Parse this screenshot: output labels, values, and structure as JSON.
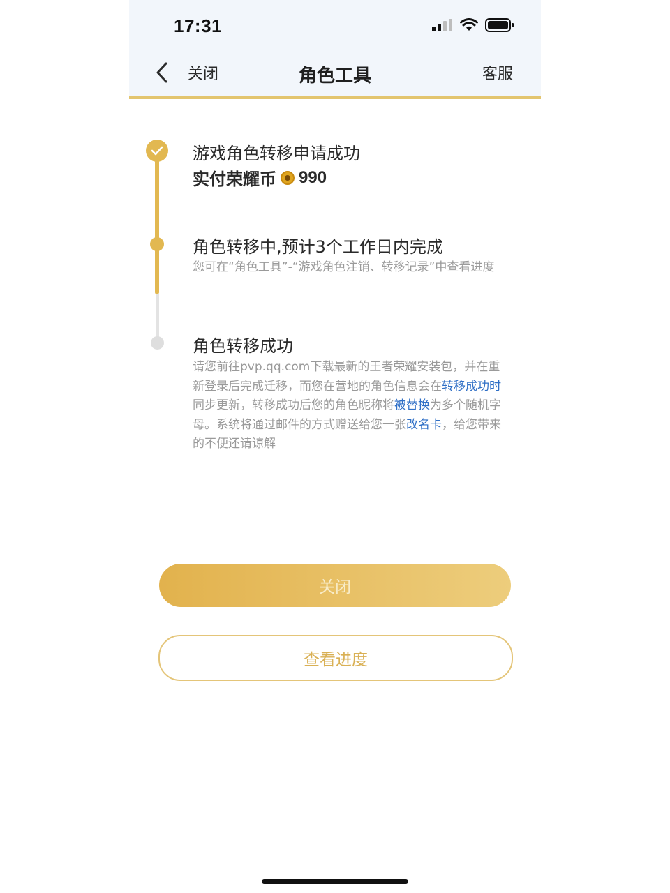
{
  "status_bar": {
    "time": "17:31"
  },
  "nav": {
    "close_label": "关闭",
    "title": "角色工具",
    "service_label": "客服"
  },
  "steps": [
    {
      "title": "游戏角色转移申请成功",
      "paid_label": "实付荣耀币",
      "paid_amount": "990",
      "state": "done"
    },
    {
      "title": "角色转移中,预计3个工作日内完成",
      "desc": "您可在“角色工具”-“游戏角色注销、转移记录”中查看进度",
      "state": "current"
    },
    {
      "title": "角色转移成功",
      "desc_parts": [
        "请您前往pvp.qq.com下载最新的王者荣耀安装包，并在重新登录后完成迁移，而您在营地的角色信息会在",
        "转移成功时",
        "同步更新，转移成功后您的角色昵称将",
        "被替换",
        "为多个随机字母。系统将通过邮件的方式赠送给您一张",
        "改名卡",
        "，给您带来的不便还请谅解"
      ],
      "state": "pending"
    }
  ],
  "buttons": {
    "primary": "关闭",
    "secondary": "查看进度"
  },
  "colors": {
    "accent": "#e2b851",
    "link": "#2f6fc6",
    "muted": "#9a9a9a"
  }
}
